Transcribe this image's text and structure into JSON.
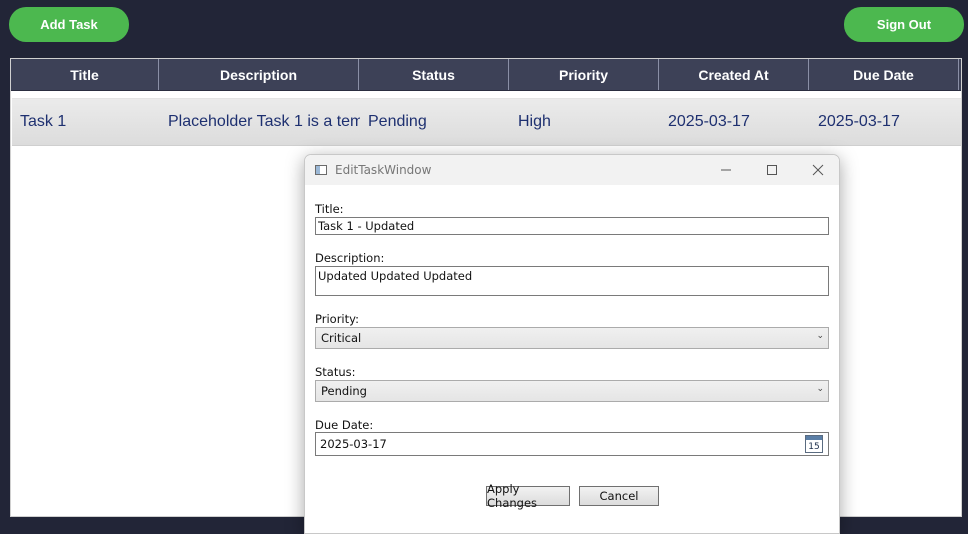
{
  "toolbar": {
    "add_task_label": "Add Task",
    "sign_out_label": "Sign Out"
  },
  "colors": {
    "background": "#222537",
    "accent_green": "#4cb84f",
    "header_bg": "#3d4157",
    "row_text": "#1e3070"
  },
  "table": {
    "columns": [
      "Title",
      "Description",
      "Status",
      "Priority",
      "Created At",
      "Due Date"
    ],
    "rows": [
      [
        "Task 1",
        "Placeholder Task 1 is a tem",
        "Pending",
        "High",
        "2025-03-17",
        "2025-03-17"
      ]
    ]
  },
  "dialog": {
    "window_title": "EditTaskWindow",
    "title_label": "Title:",
    "title_value": "Task 1 - Updated",
    "description_label": "Description:",
    "description_value": "Updated Updated Updated",
    "priority_label": "Priority:",
    "priority_value": "Critical",
    "status_label": "Status:",
    "status_value": "Pending",
    "due_date_label": "Due Date:",
    "due_date_value": "2025-03-17",
    "calendar_day": "15",
    "apply_label": "Apply Changes",
    "cancel_label": "Cancel"
  }
}
